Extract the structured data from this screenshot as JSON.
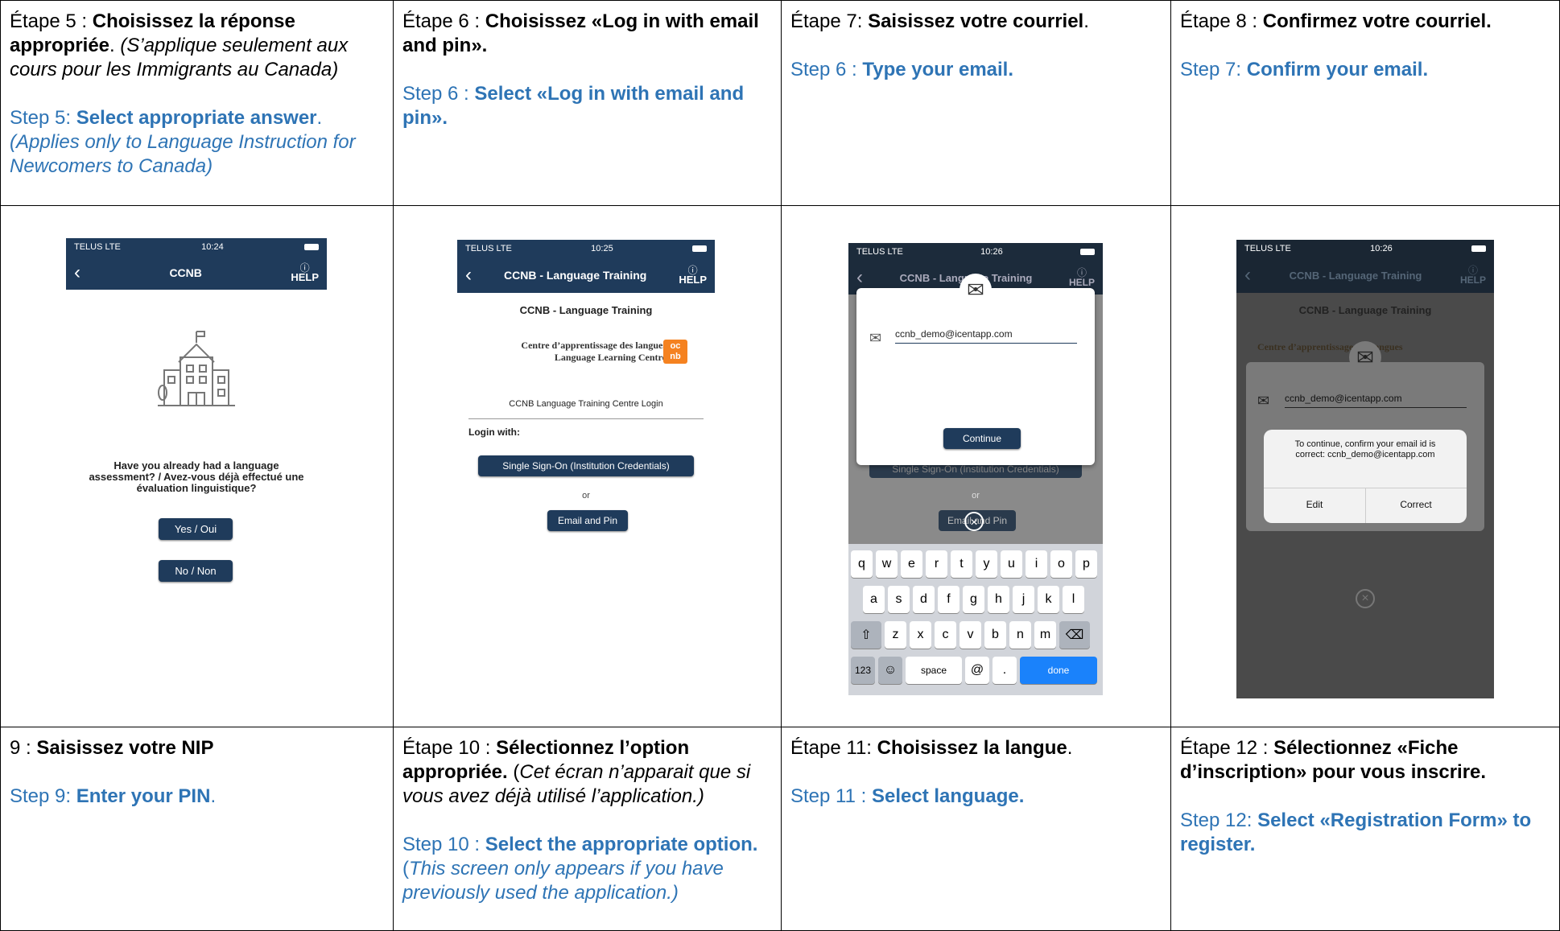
{
  "row1": [
    {
      "fr_prefix": "Étape 5 : ",
      "fr_bold": "Choisissez la réponse appropriée",
      "fr_after": ". ",
      "fr_italic": "(S’applique seulement aux cours pour les Immigrants au Canada)",
      "en_prefix": "Step 5: ",
      "en_bold": "Select appropriate answer",
      "en_after": ". ",
      "en_italic": "(Applies only to Language Instruction for Newcomers to Canada)"
    },
    {
      "fr_prefix": "Étape 6 : ",
      "fr_bold": "Choisissez «Log in with email and pin».",
      "fr_after": "",
      "fr_italic": "",
      "en_prefix": "Step 6 : ",
      "en_bold": "Select «Log in with email and pin».",
      "en_after": "",
      "en_italic": ""
    },
    {
      "fr_prefix": "Étape 7: ",
      "fr_bold": "Saisissez votre courriel",
      "fr_after": ".",
      "fr_italic": "",
      "en_prefix": "Step 6 :  ",
      "en_bold": "Type your email.",
      "en_after": "",
      "en_italic": ""
    },
    {
      "fr_prefix": "Étape 8 : ",
      "fr_bold": "Confirmez votre courriel.",
      "fr_after": "",
      "fr_italic": "",
      "en_prefix": "Step 7: ",
      "en_bold": "Confirm your email.",
      "en_after": "",
      "en_italic": ""
    }
  ],
  "row3": [
    {
      "fr_prefix": "9 : ",
      "fr_bold": "Saisissez votre NIP",
      "fr_after": "",
      "fr_italic": "",
      "en_prefix": "Step 9: ",
      "en_bold": "Enter your PIN",
      "en_after": ".",
      "en_italic": ""
    },
    {
      "fr_prefix": "Étape 10 : ",
      "fr_bold": "Sélectionnez l’option appropriée.",
      "fr_after": " (",
      "fr_italic": "Cet écran n’apparait que si vous avez déjà utilisé l’application.)",
      "en_prefix": "Step 10 : ",
      "en_bold": "Select the appropriate option.",
      "en_after": " (",
      "en_italic": "This screen only appears if you have previously used the application.)"
    },
    {
      "fr_prefix": "Étape 11: ",
      "fr_bold": "Choisissez la langue",
      "fr_after": ".",
      "fr_italic": "",
      "en_prefix": "Step 11 :  ",
      "en_bold": "Select language.",
      "en_after": "",
      "en_italic": ""
    },
    {
      "fr_prefix": "Étape 12 : ",
      "fr_bold": "Sélectionnez «Fiche d’inscription» pour vous inscrire.",
      "fr_after": "",
      "fr_italic": "",
      "en_prefix": "Step 12: ",
      "en_bold": "Select «Registration Form» to register.",
      "en_after": "",
      "en_italic": ""
    }
  ],
  "screens": {
    "s1": {
      "carrier": "TELUS  LTE",
      "time": "10:24",
      "title": "CCNB",
      "help": "HELP",
      "question": "Have you already had a language assessment? / Avez-vous déjà effectué une évaluation linguistique?",
      "yes": "Yes / Oui",
      "no": "No / Non"
    },
    "s2": {
      "carrier": "TELUS  LTE",
      "time": "10:25",
      "title": "CCNB - Language Training",
      "help": "HELP",
      "subtitle": "CCNB - Language Training",
      "logo_fr": "Centre d’apprentissage des langues",
      "logo_en": "Language Learning Centre",
      "login_title": "CCNB Language Training Centre Login",
      "login_with": "Login with:",
      "sso": "Single Sign-On (Institution Credentials)",
      "or": "or",
      "email_pin": "Email and Pin"
    },
    "s3": {
      "carrier": "TELUS  LTE",
      "time": "10:26",
      "title": "CCNB - Language Training",
      "help": "HELP",
      "email": "ccnb_demo@icentapp.com",
      "continue": "Continue",
      "sso": "Single Sign-On (Institution Credentials)",
      "or": "or",
      "email_pin": "Email and Pin",
      "row1": [
        "q",
        "w",
        "e",
        "r",
        "t",
        "y",
        "u",
        "i",
        "o",
        "p"
      ],
      "row2": [
        "a",
        "s",
        "d",
        "f",
        "g",
        "h",
        "j",
        "k",
        "l"
      ],
      "row3": [
        "z",
        "x",
        "c",
        "v",
        "b",
        "n",
        "m"
      ],
      "k123": "123",
      "space": "space",
      "at": "@",
      "dot": ".",
      "done": "done"
    },
    "s4": {
      "carrier": "TELUS  LTE",
      "time": "10:26",
      "title": "CCNB - Language Training",
      "help": "HELP",
      "subtitle": "CCNB - Language Training",
      "logo_fr": "Centre d’apprentissage des langues",
      "email": "ccnb_demo@icentapp.com",
      "confirm": "To continue, confirm your email id is correct: ccnb_demo@icentapp.com",
      "edit": "Edit",
      "correct": "Correct"
    }
  },
  "colors": {
    "text_blue": "#2e74b5",
    "nav_blue": "#1f3b5b",
    "ios_blue": "#1a82fb",
    "logo_orange": "#f58220"
  }
}
